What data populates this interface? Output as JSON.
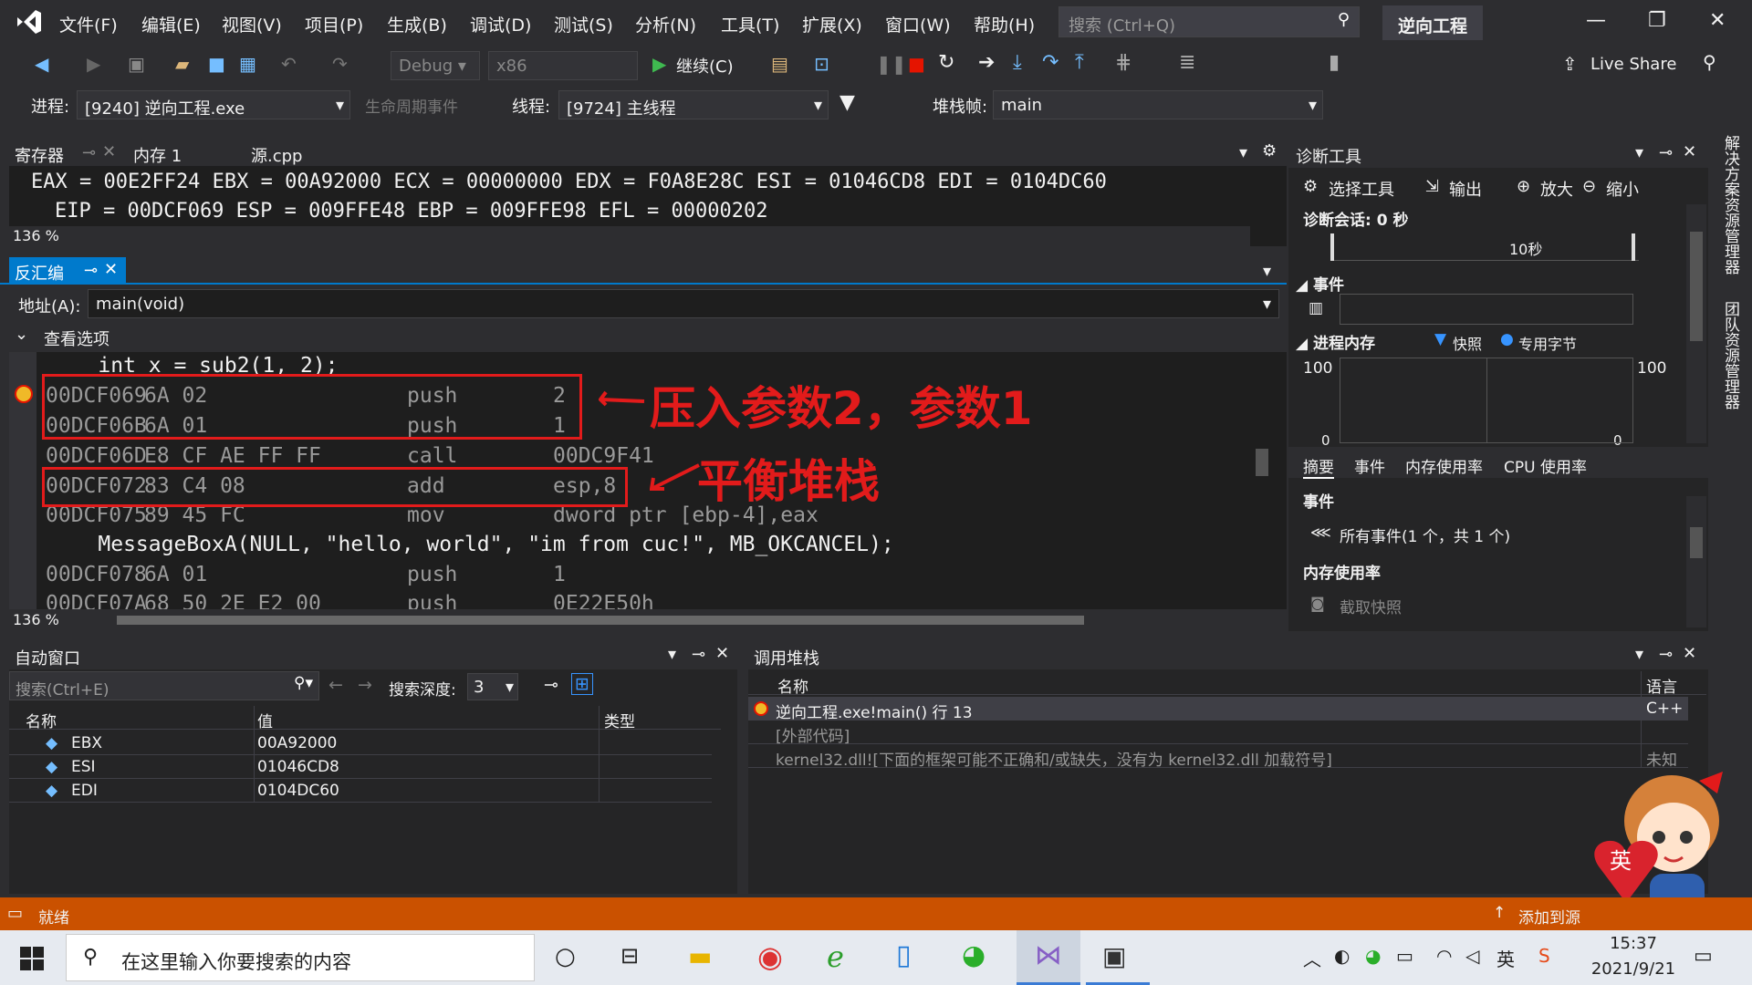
{
  "menubar": {
    "items": [
      "文件(F)",
      "编辑(E)",
      "视图(V)",
      "项目(P)",
      "生成(B)",
      "调试(D)",
      "测试(S)",
      "分析(N)",
      "工具(T)",
      "扩展(X)",
      "窗口(W)",
      "帮助(H)"
    ],
    "search_placeholder": "搜索 (Ctrl+Q)",
    "project": "逆向工程"
  },
  "toolbar": {
    "config": "Debug",
    "platform": "x86",
    "continue": "继续(C)",
    "live_share": "Live Share"
  },
  "toolbar2": {
    "process_label": "进程:",
    "process": "[9240] 逆向工程.exe",
    "lifecycle": "生命周期事件",
    "thread_label": "线程:",
    "thread": "[9724] 主线程",
    "stack_label": "堆栈帧:",
    "stack": "main"
  },
  "registers": {
    "tabs": [
      "寄存器",
      "内存 1",
      "源.cpp"
    ],
    "line1": "EAX = 00E2FF24 EBX = 00A92000 ECX = 00000000 EDX = F0A8E28C ESI = 01046CD8 EDI = 0104DC60",
    "line2": "EIP = 00DCF069 ESP = 009FFE48 EBP = 009FFE98 EFL = 00000202",
    "zoom": "136 %"
  },
  "disasm": {
    "tab": "反汇编",
    "address_label": "地址(A):",
    "address": "main(void)",
    "view_options": "查看选项",
    "zoom": "136 %",
    "lines": [
      {
        "src": "    int x = sub2(1, 2);"
      },
      {
        "addr": "00DCF069",
        "bytes": "6A 02",
        "op": "push",
        "arg": "2"
      },
      {
        "addr": "00DCF06B",
        "bytes": "6A 01",
        "op": "push",
        "arg": "1"
      },
      {
        "addr": "00DCF06D",
        "bytes": "E8 CF AE FF FF",
        "op": "call",
        "arg": "00DC9F41"
      },
      {
        "addr": "00DCF072",
        "bytes": "83 C4 08",
        "op": "add",
        "arg": "esp,8"
      },
      {
        "addr": "00DCF075",
        "bytes": "89 45 FC",
        "op": "mov",
        "arg": "dword ptr [ebp-4],eax"
      },
      {
        "src": "    MessageBoxA(NULL, \"hello, world\", \"im from cuc!\", MB_OKCANCEL);"
      },
      {
        "addr": "00DCF078",
        "bytes": "6A 01",
        "op": "push",
        "arg": "1"
      },
      {
        "addr": "00DCF07A",
        "bytes": "68 50 2E E2 00",
        "op": "push",
        "arg": "0E22E50h"
      }
    ],
    "annotation1": "压入参数2，参数1",
    "annotation2": "平衡堆栈"
  },
  "diag": {
    "title": "诊断工具",
    "select_tool": "选择工具",
    "output": "输出",
    "zoom_in": "放大",
    "zoom_out": "缩小",
    "session": "诊断会话: 0 秒",
    "time_mark": "10秒",
    "events": "事件",
    "process_memory": "进程内存",
    "snapshot": "快照",
    "private_bytes": "专用字节",
    "axis_max_left": "100",
    "axis_max_right": "100",
    "axis_zero_left": "0",
    "axis_zero_right": "0",
    "tabs": [
      "摘要",
      "事件",
      "内存使用率",
      "CPU 使用率"
    ],
    "events_header": "事件",
    "all_events": "所有事件(1 个，共 1 个)",
    "memory_usage": "内存使用率",
    "take_snapshot": "截取快照",
    "side_tabs": [
      "解决方案资源管理器",
      "团队资源管理器"
    ]
  },
  "autos": {
    "title": "自动窗口",
    "search_placeholder": "搜索(Ctrl+E)",
    "depth_label": "搜索深度:",
    "depth": "3",
    "cols": [
      "名称",
      "值",
      "类型"
    ],
    "rows": [
      {
        "name": "EBX",
        "value": "00A92000"
      },
      {
        "name": "ESI",
        "value": "01046CD8"
      },
      {
        "name": "EDI",
        "value": "0104DC60"
      }
    ]
  },
  "callstack": {
    "title": "调用堆栈",
    "cols": [
      "名称",
      "语言"
    ],
    "rows": [
      {
        "name": "逆向工程.exe!main() 行 13",
        "lang": "C++"
      },
      {
        "name": "[外部代码]",
        "lang": ""
      },
      {
        "name": "kernel32.dll![下面的框架可能不正确和/或缺失，没有为 kernel32.dll 加载符号]",
        "lang": "未知"
      }
    ]
  },
  "status": {
    "text": "就绪",
    "right": "添加到源"
  },
  "taskbar": {
    "search": "在这里输入你要搜索的内容",
    "time": "15:37",
    "date": "2021/9/21",
    "ime": "英"
  }
}
